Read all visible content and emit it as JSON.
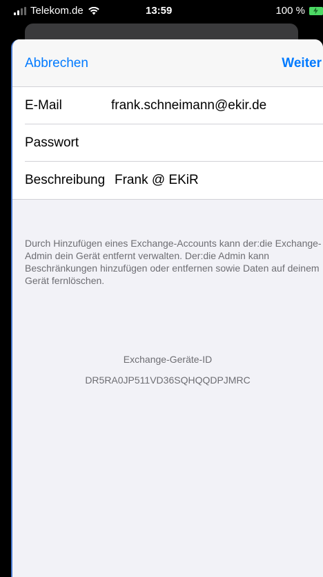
{
  "status_bar": {
    "carrier": "Telekom.de",
    "time": "13:59",
    "battery_percent": "100 %",
    "icons": [
      "signal-icon",
      "wifi-icon",
      "battery-charging-icon"
    ],
    "battery_color": "#4cd964"
  },
  "nav": {
    "cancel_label": "Abbrechen",
    "next_label": "Weiter",
    "accent_color": "#007aff"
  },
  "form": {
    "email_label": "E-Mail",
    "email_value": "frank.schneimann@ekir.de",
    "password_label": "Passwort",
    "password_value": "",
    "description_label": "Beschreibung",
    "description_value": "Frank @ EKiR"
  },
  "info": {
    "text": "Durch Hinzufügen eines Exchange-Accounts kann der:die Exchange-Admin dein Gerät entfernt verwalten. Der:die Admin kann Beschränkungen hinzufügen oder entfernen sowie Daten auf deinem Gerät fernlöschen.",
    "device_id_label": "Exchange-Geräte-ID",
    "device_id_value": "DR5RA0JP511VD36SQHQQDPJMRC"
  }
}
